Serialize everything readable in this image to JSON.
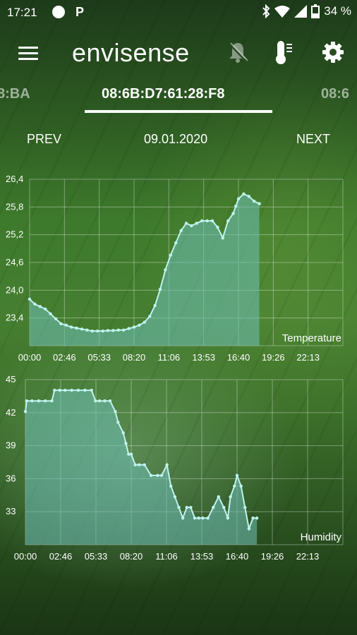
{
  "status_bar": {
    "time": "17:21",
    "p_icon": "P",
    "battery": "34 %"
  },
  "app": {
    "title": "envisense"
  },
  "icons": {
    "menu": "menu-icon",
    "bell": "bell-off-icon",
    "thermometer": "thermometer-icon",
    "settings": "gear-icon"
  },
  "tabs": {
    "left": "8:BA",
    "center": "08:6B:D7:61:28:F8",
    "right": "08:6"
  },
  "nav": {
    "prev": "PREV",
    "date": "09.01.2020",
    "next": "NEXT"
  },
  "colors": {
    "fill": "#6fbfb8",
    "line": "#bff3ee"
  },
  "chart_data": [
    {
      "type": "area",
      "title": "Temperature",
      "x_ticks": [
        "00:00",
        "02:46",
        "05:33",
        "08:20",
        "11:06",
        "13:53",
        "16:40",
        "19:26",
        "22:13"
      ],
      "y_ticks": [
        "26,4",
        "25,8",
        "25,2",
        "24,6",
        "24,0",
        "23,4"
      ],
      "ylim": [
        23.0,
        26.4
      ],
      "x_unit": "hours",
      "x": [
        0,
        0.4,
        0.8,
        1.2,
        1.6,
        2.0,
        2.4,
        2.8,
        3.2,
        3.6,
        4.0,
        4.4,
        4.8,
        5.2,
        5.6,
        6.0,
        6.4,
        6.8,
        7.2,
        7.6,
        8.0,
        8.4,
        8.8,
        9.2,
        9.6,
        10.0,
        10.4,
        10.8,
        11.2,
        11.6,
        12.0,
        12.4,
        12.8,
        13.2,
        13.6,
        14.0,
        14.4,
        14.8,
        15.2,
        15.6,
        15.8,
        16.0,
        16.4,
        16.8,
        17.2,
        17.6
      ],
      "y": [
        23.95,
        23.85,
        23.8,
        23.75,
        23.65,
        23.55,
        23.45,
        23.42,
        23.38,
        23.36,
        23.34,
        23.32,
        23.3,
        23.3,
        23.3,
        23.31,
        23.31,
        23.32,
        23.32,
        23.35,
        23.38,
        23.42,
        23.48,
        23.6,
        23.82,
        24.15,
        24.55,
        24.85,
        25.1,
        25.35,
        25.5,
        25.45,
        25.5,
        25.55,
        25.55,
        25.55,
        25.42,
        25.2,
        25.55,
        25.7,
        25.85,
        26.0,
        26.1,
        26.05,
        25.95,
        25.9
      ]
    },
    {
      "type": "area",
      "title": "Humidity",
      "x_ticks": [
        "00:00",
        "02:46",
        "05:33",
        "08:20",
        "11:06",
        "13:53",
        "16:40",
        "19:26",
        "22:13"
      ],
      "y_ticks": [
        "45",
        "42",
        "39",
        "36",
        "33"
      ],
      "ylim": [
        30.5,
        46
      ],
      "x_unit": "hours",
      "x": [
        0,
        0.1,
        0.5,
        1.0,
        1.5,
        2.0,
        2.2,
        2.6,
        3.0,
        3.5,
        4.0,
        4.5,
        5.0,
        5.3,
        5.6,
        6.0,
        6.4,
        6.8,
        7.0,
        7.4,
        7.6,
        7.8,
        8.0,
        8.3,
        8.6,
        9.0,
        9.5,
        10.0,
        10.3,
        10.7,
        11.0,
        11.3,
        11.6,
        11.9,
        12.2,
        12.5,
        12.8,
        13.1,
        13.4,
        13.8,
        14.2,
        14.6,
        15.0,
        15.3,
        15.5,
        15.8,
        16.0,
        16.3,
        16.6,
        16.9,
        17.2,
        17.5
      ],
      "y": [
        43,
        44,
        44,
        44,
        44,
        44,
        45,
        45,
        45,
        45,
        45,
        45,
        45,
        44,
        44,
        44,
        44,
        43,
        42,
        41,
        40,
        39,
        39,
        38,
        38,
        38,
        37,
        37,
        37,
        38,
        36,
        35,
        34,
        33,
        34,
        34,
        33,
        33,
        33,
        33,
        34,
        35,
        34,
        33,
        35,
        36,
        37,
        36,
        34,
        32,
        33,
        33
      ]
    }
  ]
}
